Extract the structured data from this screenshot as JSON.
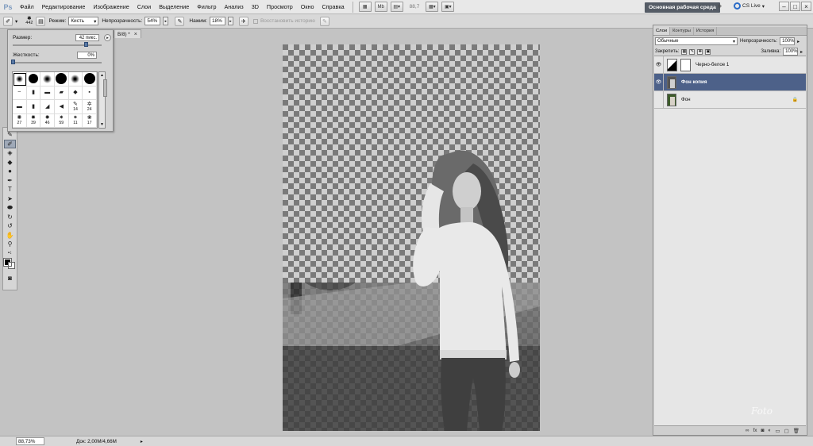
{
  "menubar": {
    "logo": "Ps",
    "items": [
      "Файл",
      "Редактирование",
      "Изображение",
      "Слои",
      "Выделение",
      "Фильтр",
      "Анализ",
      "3D",
      "Просмотр",
      "Окно",
      "Справка"
    ],
    "mb_label": "Mb",
    "zoom_value": "88,7",
    "workspace": "Основная рабочая среда",
    "cs_live": "CS Live"
  },
  "options": {
    "brush_size": "442",
    "mode_label": "Режим:",
    "mode_value": "Кисть",
    "opacity_label": "Непрозрачность:",
    "opacity_value": "54%",
    "flow_label": "Нажим:",
    "flow_value": "18%",
    "history_label": "Восстановить историю"
  },
  "document_tab": {
    "title": "B/8) *"
  },
  "brush_panel": {
    "size_label": "Размер:",
    "size_value": "42 пикс.",
    "hardness_label": "Жесткость:",
    "hardness_value": "0%",
    "presets": [
      {
        "glyph": "soft",
        "num": ""
      },
      {
        "glyph": "hard",
        "num": ""
      },
      {
        "glyph": "soft",
        "num": ""
      },
      {
        "glyph": "hard",
        "num": ""
      },
      {
        "glyph": "soft",
        "num": ""
      },
      {
        "glyph": "hard",
        "num": ""
      },
      {
        "glyph": "~",
        "num": ""
      },
      {
        "glyph": "▮",
        "num": ""
      },
      {
        "glyph": "▬",
        "num": ""
      },
      {
        "glyph": "▰",
        "num": ""
      },
      {
        "glyph": "◆",
        "num": ""
      },
      {
        "glyph": "▪",
        "num": ""
      },
      {
        "glyph": "▬",
        "num": ""
      },
      {
        "glyph": "▮",
        "num": ""
      },
      {
        "glyph": "◢",
        "num": ""
      },
      {
        "glyph": "◀",
        "num": ""
      },
      {
        "glyph": "✎",
        "num": "14"
      },
      {
        "glyph": "✲",
        "num": "24"
      },
      {
        "glyph": "✺",
        "num": "27"
      },
      {
        "glyph": "✸",
        "num": "39"
      },
      {
        "glyph": "✹",
        "num": "46"
      },
      {
        "glyph": "✷",
        "num": "59"
      },
      {
        "glyph": "⁕",
        "num": "11"
      },
      {
        "glyph": "❀",
        "num": "17"
      }
    ]
  },
  "statusbar": {
    "zoom": "88,73%",
    "doc_info": "Док: 2,00M/4,66M"
  },
  "layers_panel": {
    "tabs": [
      "Слои",
      "Контуры",
      "История"
    ],
    "blend_mode": "Обычные",
    "opacity_label": "Непрозрачность:",
    "opacity_value": "100%",
    "lock_label": "Закрепить:",
    "fill_label": "Заливка:",
    "fill_value": "100%",
    "layers": [
      {
        "name": "Черно-белое 1",
        "visible": true,
        "selected": false,
        "type": "adjustment"
      },
      {
        "name": "Фон копия",
        "visible": true,
        "selected": true,
        "type": "image"
      },
      {
        "name": "Фон",
        "visible": false,
        "selected": false,
        "type": "image",
        "locked": true
      }
    ]
  },
  "watermark": "Foto"
}
